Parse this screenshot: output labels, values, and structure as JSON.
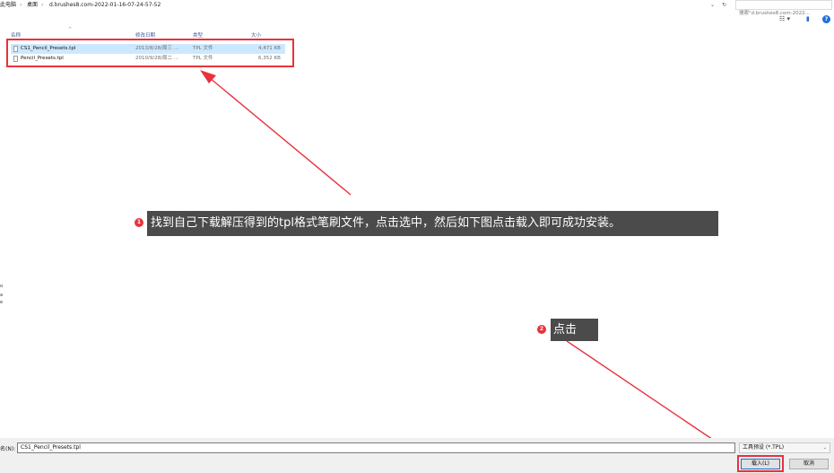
{
  "address_bar": {
    "crumbs": [
      "此电脑",
      "桌面",
      "d.brushes8.com-2022-01-16-07-24-57-52"
    ],
    "separator": "›",
    "dropdown_glyph": "⌄",
    "refresh_glyph": "↻",
    "search_placeholder": "搜索\"d.brushes8.com-2022..."
  },
  "toolbar": {
    "view_icon": "view-options-icon",
    "view_glyph": "☷ ▾",
    "pane_icon": "preview-pane-icon",
    "pane_glyph": "▮",
    "help_icon": "help-icon",
    "help_glyph": "?"
  },
  "columns": {
    "name": "名称",
    "modified": "修改日期",
    "type": "类型",
    "size": "大小",
    "sort_glyph": "^"
  },
  "files": [
    {
      "name": "CS1_Pencil_Presets.tpl",
      "modified": "2013/8/28/周三 ...",
      "type": "TPL 文件",
      "size": "4,471 KB",
      "selected": true
    },
    {
      "name": "Pencil_Presets.tpl",
      "modified": "2010/9/28/周二 ...",
      "type": "TPL 文件",
      "size": "6,352 KB",
      "selected": false
    }
  ],
  "annotations": {
    "step1_number": "1",
    "step1_text": "找到自己下载解压得到的tpl格式笔刷文件，点击选中，然后如下图点击载入即可成功安装。",
    "step2_number": "2",
    "step2_text": "点击",
    "accent_color": "#e8323c",
    "callout_bg": "#4b4b4b"
  },
  "left_edge_marks": [
    "o",
    "a",
    "e"
  ],
  "footer": {
    "filename_label": "名(N):",
    "filename_value": "CS1_Pencil_Presets.tpl",
    "filetype_value": "工具预设 (*.TPL)",
    "chevron_glyph": "⌄",
    "load_button": "载入(L)",
    "cancel_button": "取消"
  }
}
